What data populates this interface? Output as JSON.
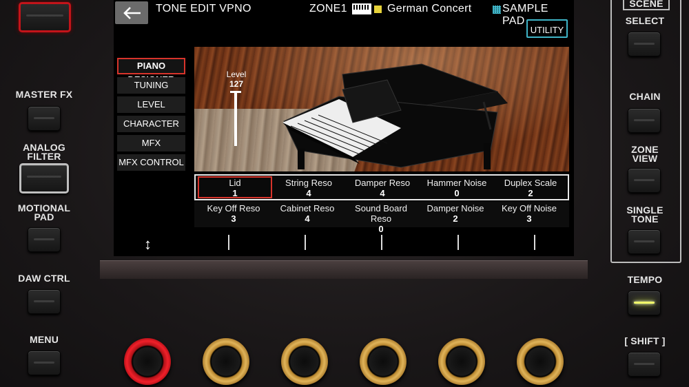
{
  "screen": {
    "topbar": {
      "title": "TONE EDIT VPNO",
      "zone": "ZONE1",
      "tone_name": "German Concert",
      "sample_pad": "SAMPLE PAD",
      "utility": "UTILITY"
    },
    "menu": [
      "PIANO DESIGNER",
      "TUNING",
      "LEVEL",
      "CHARACTER",
      "MFX",
      "MFX CONTROL"
    ],
    "level": {
      "label": "Level",
      "value": "127"
    },
    "params_row1": [
      {
        "name": "Lid",
        "value": "1"
      },
      {
        "name": "String Reso",
        "value": "4"
      },
      {
        "name": "Damper Reso",
        "value": "4"
      },
      {
        "name": "Hammer Noise",
        "value": "0"
      },
      {
        "name": "Duplex Scale",
        "value": "2"
      }
    ],
    "params_row2": [
      {
        "name": "Key Off Reso",
        "value": "3"
      },
      {
        "name": "Cabinet Reso",
        "value": "4"
      },
      {
        "name": "Sound Board Reso",
        "value": "0"
      },
      {
        "name": "Damper Noise",
        "value": "2"
      },
      {
        "name": "Key Off Noise",
        "value": "3"
      }
    ],
    "softkey_symbol": "↕"
  },
  "hardware": {
    "left": [
      "MASTER FX",
      "ANALOG FILTER",
      "MOTIONAL PAD",
      "DAW CTRL",
      "MENU"
    ],
    "right": {
      "scene": "SCENE",
      "select": "SELECT",
      "chain": "CHAIN",
      "zone_view": "ZONE VIEW",
      "single_tone": "SINGLE TONE",
      "tempo": "TEMPO",
      "shift": "[ SHIFT ]"
    }
  },
  "colors": {
    "accent_red": "#d8342b",
    "utility_cyan": "#3fb5c8",
    "knob_gold": "#e0b45a",
    "tempo_led": "#f2ff6a"
  }
}
